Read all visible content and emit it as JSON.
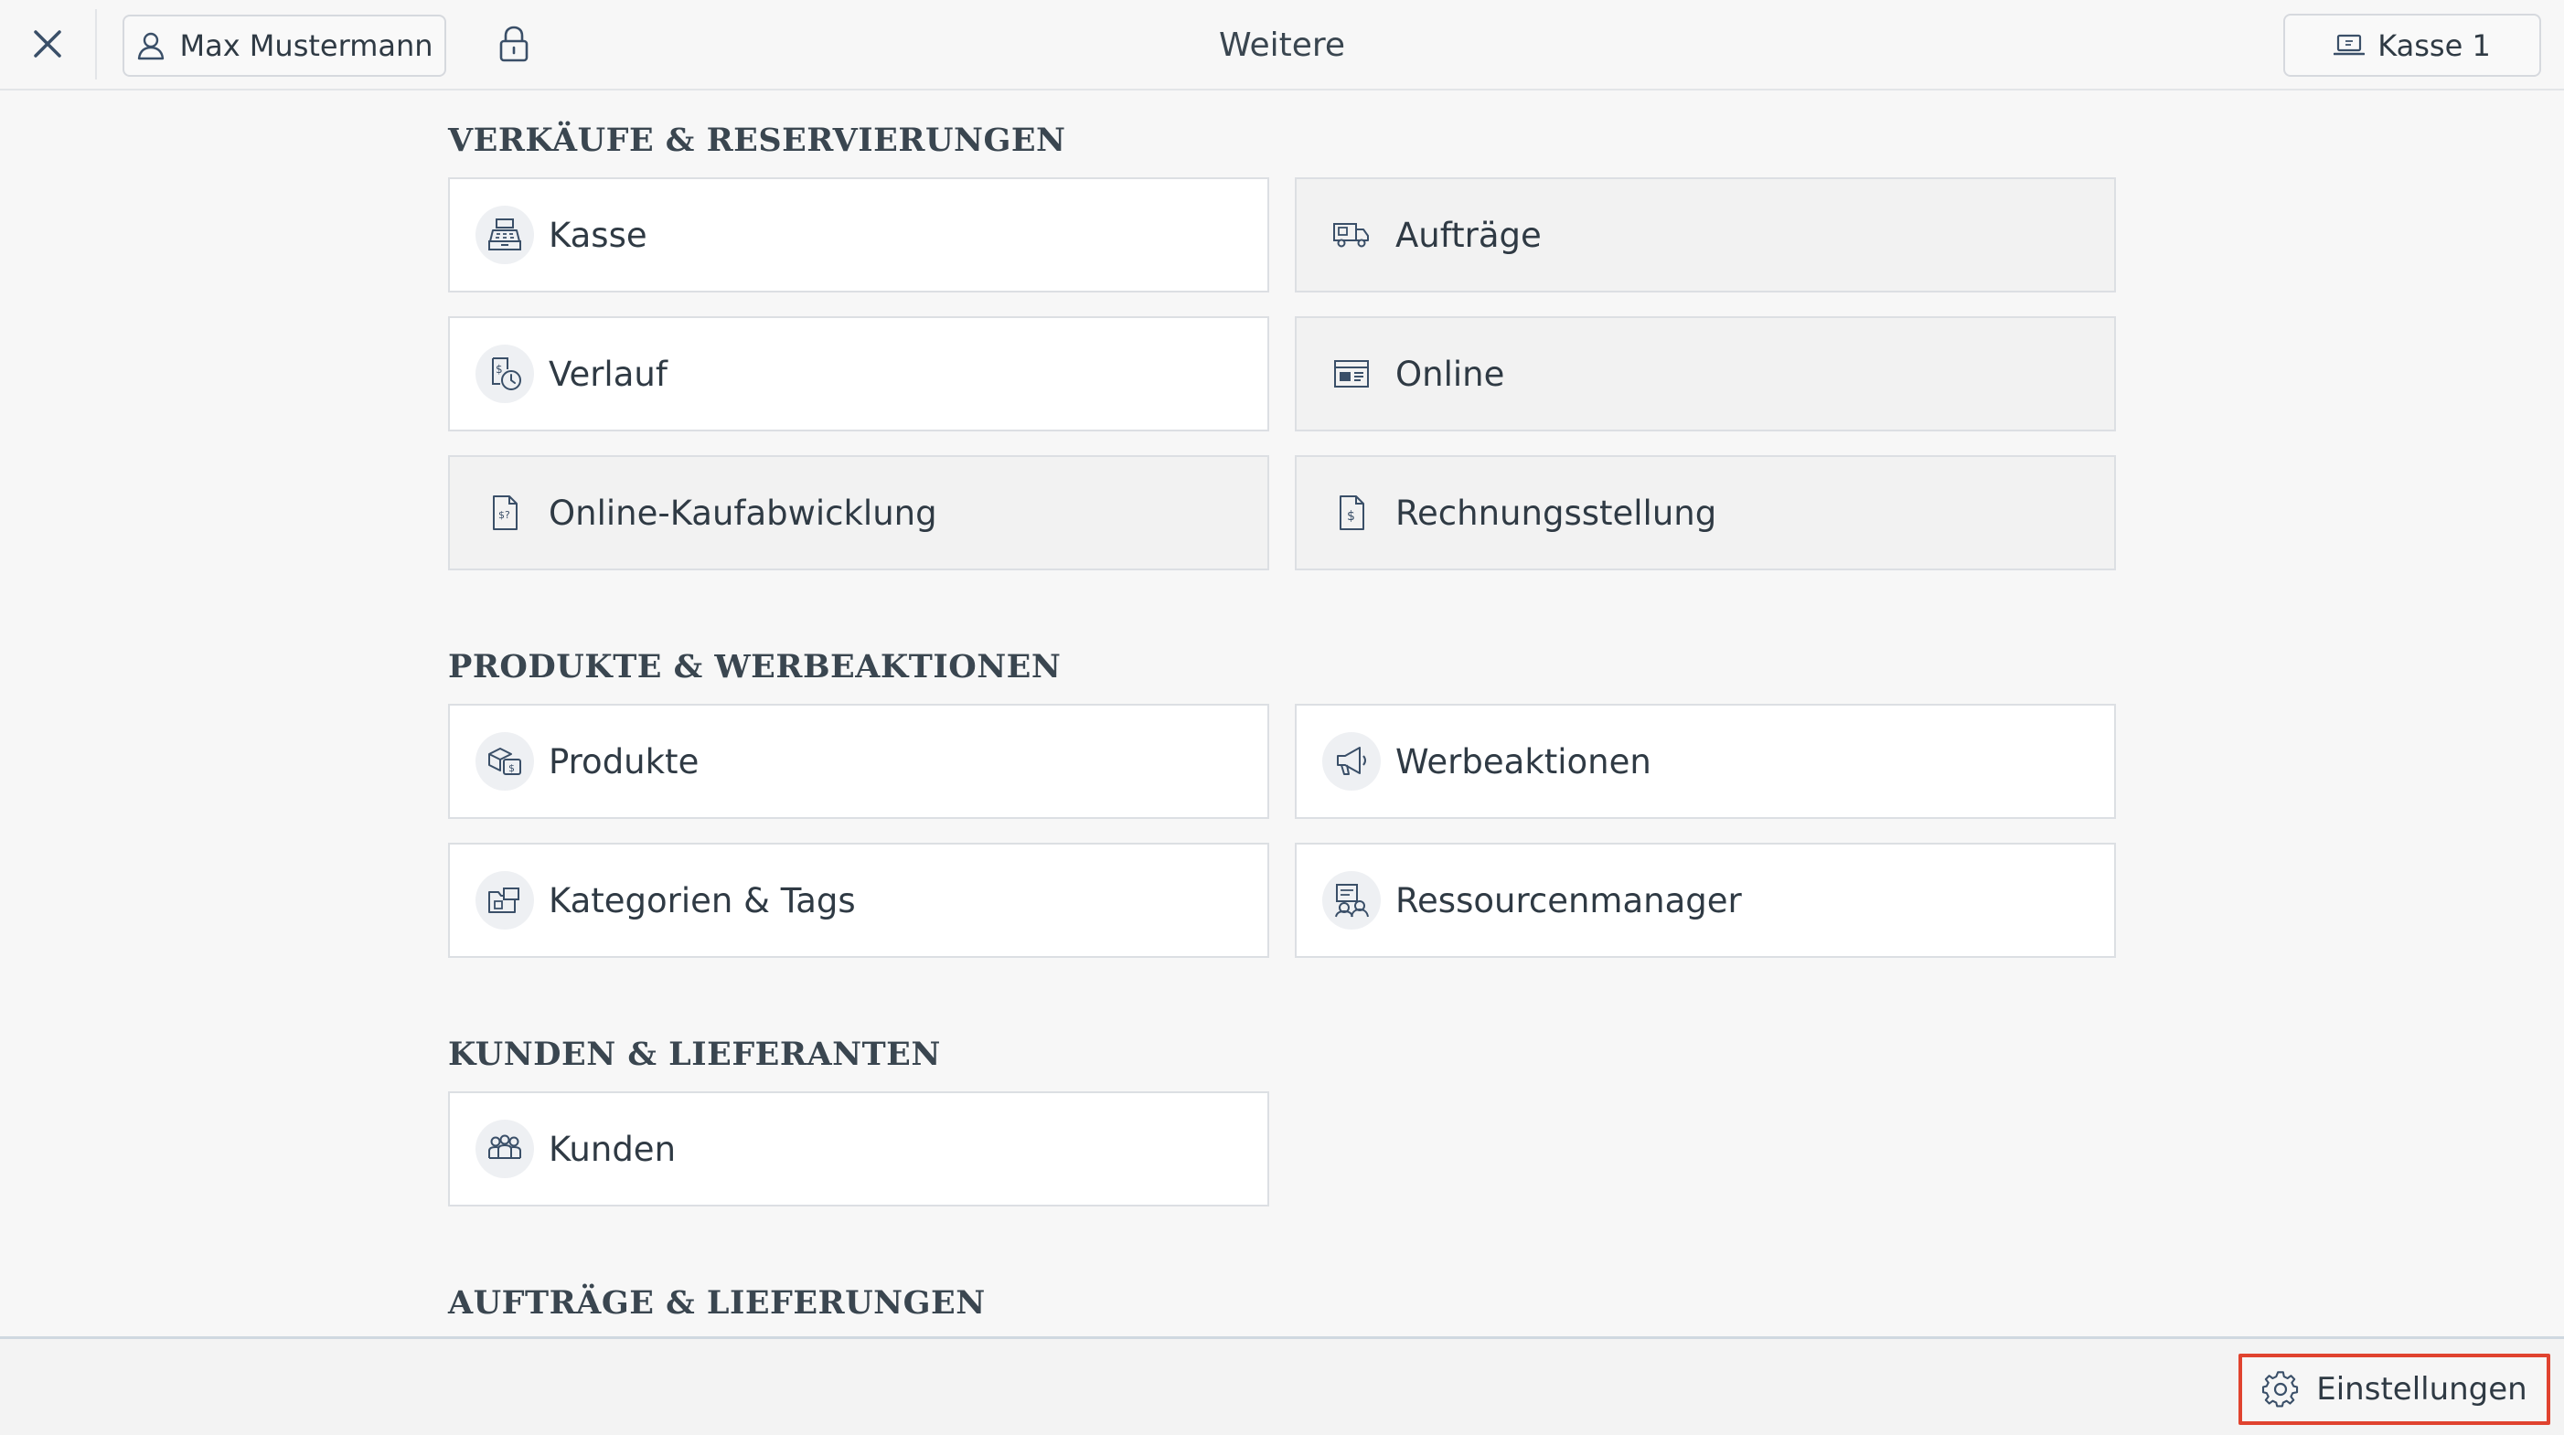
{
  "header": {
    "title": "Weitere",
    "user_name": "Max Mustermann",
    "register_label": "Kasse 1"
  },
  "sections": [
    {
      "title": "VERKÄUFE & RESERVIERUNGEN",
      "items": [
        {
          "label": "Kasse",
          "icon": "cash-register-icon",
          "disabled": false
        },
        {
          "label": "Aufträge",
          "icon": "delivery-truck-icon",
          "disabled": true
        },
        {
          "label": "Verlauf",
          "icon": "history-clock-icon",
          "disabled": false
        },
        {
          "label": "Online",
          "icon": "online-store-icon",
          "disabled": true
        },
        {
          "label": "Online-Kaufabwicklung",
          "icon": "online-checkout-document-icon",
          "disabled": true
        },
        {
          "label": "Rechnungsstellung",
          "icon": "invoice-document-icon",
          "disabled": true
        }
      ]
    },
    {
      "title": "PRODUKTE & WERBEAKTIONEN",
      "items": [
        {
          "label": "Produkte",
          "icon": "products-box-icon",
          "disabled": false
        },
        {
          "label": "Werbeaktionen",
          "icon": "megaphone-icon",
          "disabled": false
        },
        {
          "label": "Kategorien & Tags",
          "icon": "folder-tag-icon",
          "disabled": false
        },
        {
          "label": "Ressourcenmanager",
          "icon": "resource-manager-icon",
          "disabled": false
        }
      ]
    },
    {
      "title": "KUNDEN & LIEFERANTEN",
      "items": [
        {
          "label": "Kunden",
          "icon": "customers-group-icon",
          "disabled": false
        }
      ]
    },
    {
      "title": "AUFTRÄGE & LIEFERUNGEN",
      "items": []
    }
  ],
  "footer": {
    "settings_label": "Einstellungen"
  },
  "colors": {
    "icon_stroke": "#3a4f68",
    "highlight_border": "#e0432f",
    "disabled_tile": "#f2f2f2"
  }
}
